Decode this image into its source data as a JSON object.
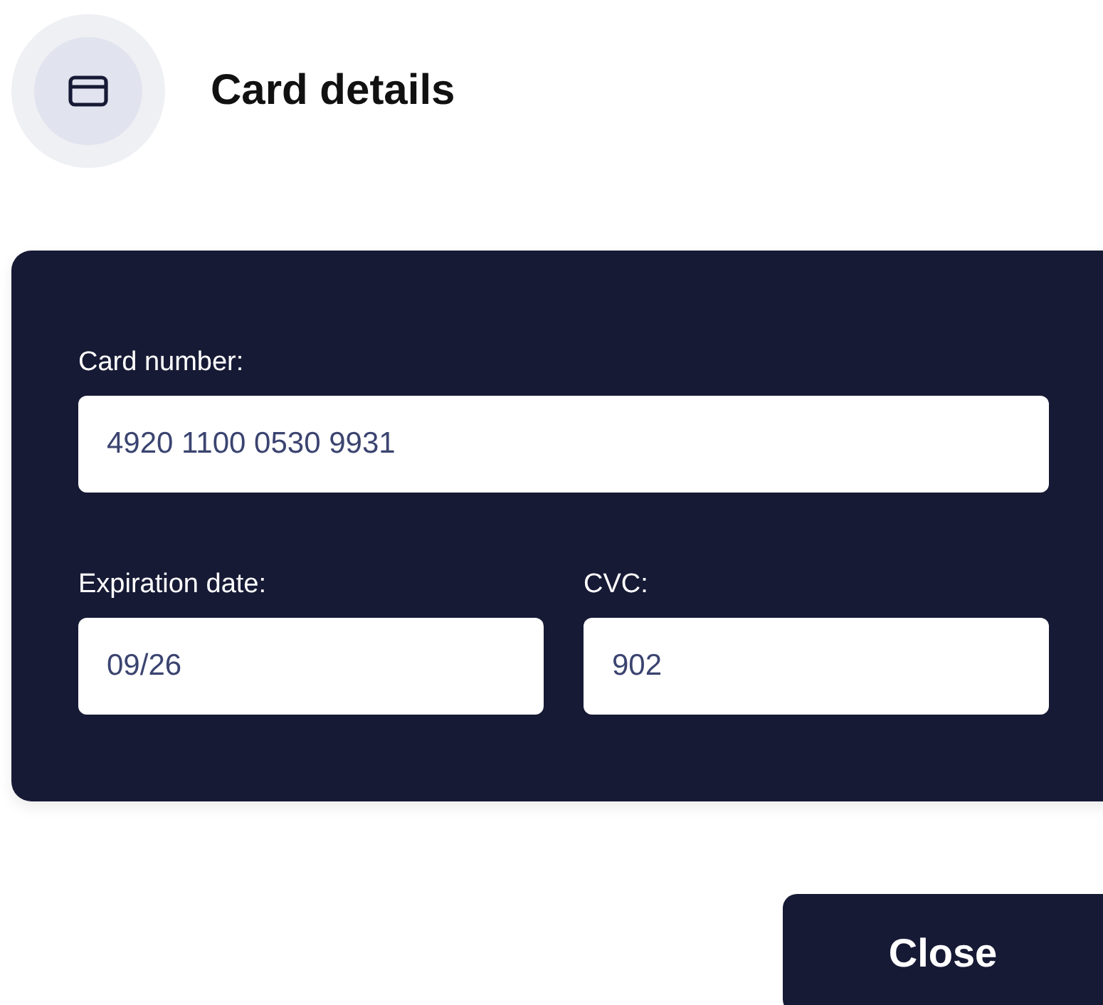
{
  "header": {
    "title": "Card details"
  },
  "card_form": {
    "fields": [
      {
        "label": "Card number:",
        "value": "4920 1100 0530 9931"
      },
      {
        "label": "Expiration date:",
        "value": "09/26"
      },
      {
        "label": "CVC:",
        "value": "902"
      }
    ]
  },
  "buttons": [
    "Close"
  ]
}
